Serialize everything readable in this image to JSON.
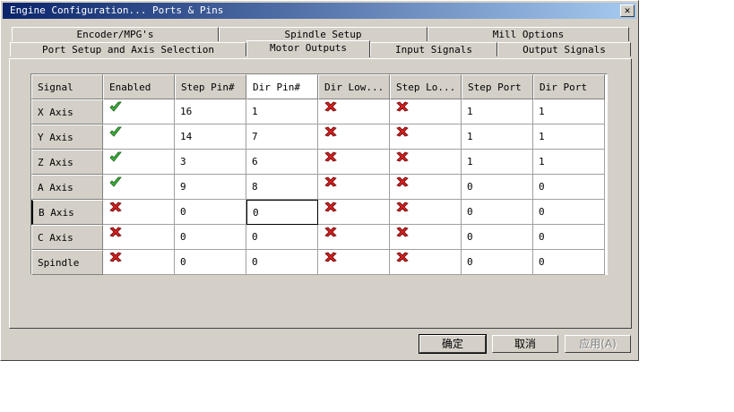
{
  "window": {
    "title": "Engine Configuration... Ports & Pins",
    "close_glyph": "✕"
  },
  "tabs_back_row": [
    {
      "label": "Encoder/MPG's"
    },
    {
      "label": "Spindle Setup"
    },
    {
      "label": "Mill Options"
    }
  ],
  "tabs_front_row": [
    {
      "label": "Port Setup and Axis Selection"
    },
    {
      "label": "Motor Outputs",
      "active": true
    },
    {
      "label": "Input Signals"
    },
    {
      "label": "Output Signals"
    }
  ],
  "grid": {
    "columns": [
      "Signal",
      "Enabled",
      "Step Pin#",
      "Dir Pin#",
      "Dir Low...",
      "Step Lo...",
      "Step Port",
      "Dir Port"
    ],
    "rows": [
      {
        "signal": "X Axis",
        "enabled": "check",
        "step_pin": "16",
        "dir_pin": "1",
        "dir_low": "cross",
        "step_low": "cross",
        "step_port": "1",
        "dir_port": "1"
      },
      {
        "signal": "Y Axis",
        "enabled": "check",
        "step_pin": "14",
        "dir_pin": "7",
        "dir_low": "cross",
        "step_low": "cross",
        "step_port": "1",
        "dir_port": "1"
      },
      {
        "signal": "Z Axis",
        "enabled": "check",
        "step_pin": "3",
        "dir_pin": "6",
        "dir_low": "cross",
        "step_low": "cross",
        "step_port": "1",
        "dir_port": "1"
      },
      {
        "signal": "A Axis",
        "enabled": "check",
        "step_pin": "9",
        "dir_pin": "8",
        "dir_low": "cross",
        "step_low": "cross",
        "step_port": "0",
        "dir_port": "0"
      },
      {
        "signal": "B Axis",
        "enabled": "cross",
        "step_pin": "0",
        "dir_pin": "0",
        "dir_low": "cross",
        "step_low": "cross",
        "step_port": "0",
        "dir_port": "0"
      },
      {
        "signal": "C Axis",
        "enabled": "cross",
        "step_pin": "0",
        "dir_pin": "0",
        "dir_low": "cross",
        "step_low": "cross",
        "step_port": "0",
        "dir_port": "0"
      },
      {
        "signal": "Spindle",
        "enabled": "cross",
        "step_pin": "0",
        "dir_pin": "0",
        "dir_low": "cross",
        "step_low": "cross",
        "step_port": "0",
        "dir_port": "0"
      }
    ]
  },
  "buttons": {
    "ok": "确定",
    "cancel": "取消",
    "apply": "应用(A)"
  },
  "colors": {
    "check": "#3cb43c",
    "cross": "#d42020",
    "titlebar_start": "#0a246a",
    "titlebar_end": "#a6caf0"
  }
}
